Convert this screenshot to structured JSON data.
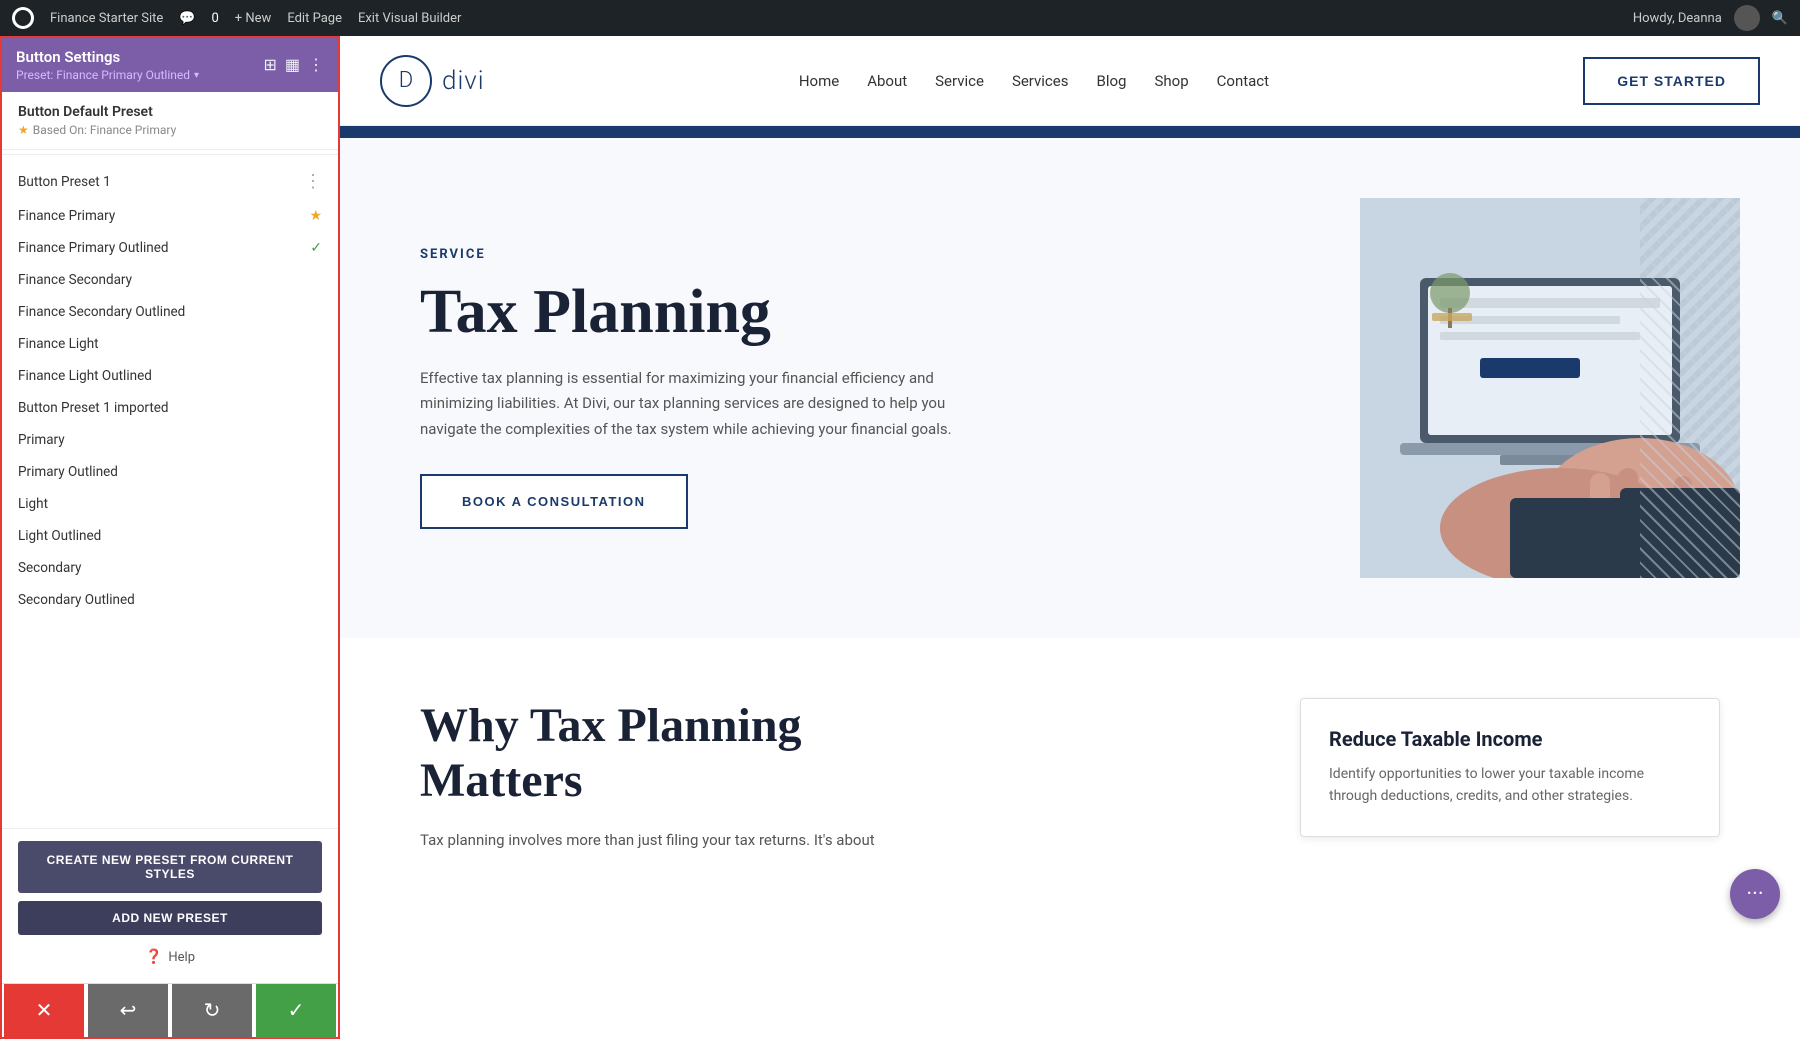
{
  "adminBar": {
    "wpLogo": "W",
    "siteName": "Finance Starter Site",
    "commentCount": "0",
    "newLabel": "+ New",
    "editPage": "Edit Page",
    "exitBuilder": "Exit Visual Builder",
    "howdy": "Howdy, Deanna"
  },
  "leftPanel": {
    "title": "Button Settings",
    "preset": "Preset: Finance Primary Outlined",
    "defaultPreset": {
      "title": "Button Default Preset",
      "basedOn": "Based On: Finance Primary"
    },
    "presets": [
      {
        "id": "btn-preset-1",
        "name": "Button Preset 1",
        "icon": "dots"
      },
      {
        "id": "finance-primary",
        "name": "Finance Primary",
        "icon": "star"
      },
      {
        "id": "finance-primary-outlined",
        "name": "Finance Primary Outlined",
        "icon": "check"
      },
      {
        "id": "finance-secondary",
        "name": "Finance Secondary",
        "icon": "none"
      },
      {
        "id": "finance-secondary-outlined",
        "name": "Finance Secondary Outlined",
        "icon": "none"
      },
      {
        "id": "finance-light",
        "name": "Finance Light",
        "icon": "none"
      },
      {
        "id": "finance-light-outlined",
        "name": "Finance Light Outlined",
        "icon": "none"
      },
      {
        "id": "btn-preset-1-imported",
        "name": "Button Preset 1 imported",
        "icon": "none"
      },
      {
        "id": "primary",
        "name": "Primary",
        "icon": "none"
      },
      {
        "id": "primary-outlined",
        "name": "Primary Outlined",
        "icon": "none"
      },
      {
        "id": "light",
        "name": "Light",
        "icon": "none"
      },
      {
        "id": "light-outlined",
        "name": "Light Outlined",
        "icon": "none"
      },
      {
        "id": "secondary",
        "name": "Secondary",
        "icon": "none"
      },
      {
        "id": "secondary-outlined",
        "name": "Secondary Outlined",
        "icon": "none"
      }
    ],
    "createPresetBtn": "CREATE NEW PRESET FROM CURRENT STYLES",
    "addPresetBtn": "ADD NEW PRESET",
    "helpLabel": "Help"
  },
  "bottomToolbar": {
    "cancelLabel": "✕",
    "undoLabel": "↩",
    "redoLabel": "↻",
    "saveLabel": "✓"
  },
  "siteNav": {
    "logoLetter": "D",
    "logoText": "divi",
    "links": [
      "Home",
      "About",
      "Service",
      "Services",
      "Blog",
      "Shop",
      "Contact"
    ],
    "ctaButton": "GET STARTED"
  },
  "heroSection": {
    "label": "SERVICE",
    "title": "Tax Planning",
    "description": "Effective tax planning is essential for maximizing your financial efficiency and minimizing liabilities. At Divi, our tax planning services are designed to help you navigate the complexities of the tax system while achieving your financial goals.",
    "ctaButton": "BOOK A CONSULTATION"
  },
  "section2": {
    "title": "Why Tax Planning Matters",
    "description": "Tax planning involves more than just filing your tax returns. It's about",
    "infoCard": {
      "title": "Reduce Taxable Income",
      "text": "Identify opportunities to lower your taxable income through deductions, credits, and other strategies."
    }
  }
}
